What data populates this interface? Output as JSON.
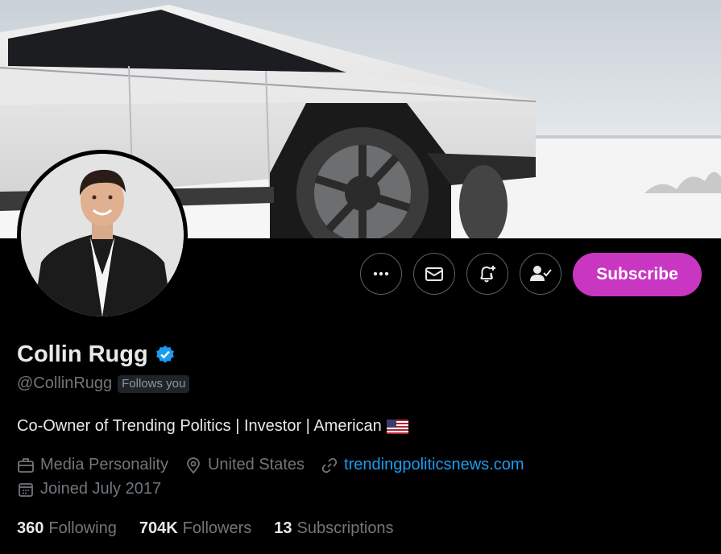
{
  "profile": {
    "name": "Collin Rugg",
    "handle": "@CollinRugg",
    "follows_you": "Follows you",
    "bio": "Co-Owner of Trending Politics | Investor | American",
    "category": "Media Personality",
    "location": "United States",
    "website": "trendingpoliticsnews.com",
    "joined": "Joined July 2017"
  },
  "stats": {
    "following_count": "360",
    "following_label": "Following",
    "followers_count": "704K",
    "followers_label": "Followers",
    "subscriptions_count": "13",
    "subscriptions_label": "Subscriptions"
  },
  "actions": {
    "more_icon": "more-horizontal-icon",
    "message_icon": "envelope-icon",
    "notify_icon": "bell-plus-icon",
    "following_icon": "user-check-icon",
    "subscribe_label": "Subscribe"
  },
  "colors": {
    "background": "#000000",
    "accent_subscribe": "#c936c2",
    "link": "#1d9bf0",
    "verified": "#1d9bf0",
    "secondary_text": "#71767b"
  }
}
